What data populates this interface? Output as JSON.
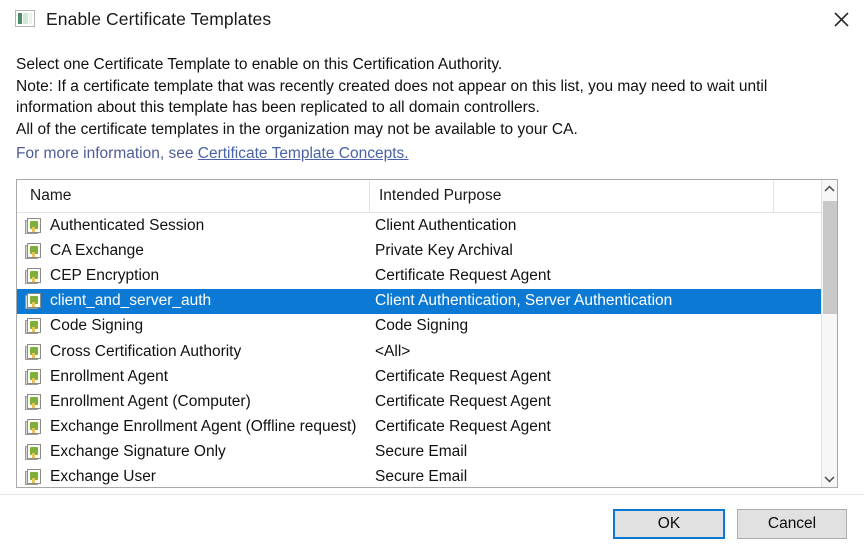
{
  "window": {
    "title": "Enable Certificate Templates",
    "icon": "certificate-templates-icon",
    "close_label": "✕",
    "accent_color": "#0c7ad4"
  },
  "description": {
    "lines": [
      "Select one Certificate Template to enable on this Certification Authority.",
      "Note: If a certificate template that was recently created does not appear on this list, you may need to wait until",
      "information about this template has been replicated to all domain controllers.",
      "All of the certificate templates in the organization may not be available to your CA."
    ],
    "link_prefix": "For more information, see ",
    "link_text": "Certificate Template Concepts.",
    "link_color": "#4a63a8"
  },
  "list": {
    "columns": [
      "Name",
      "Intended Purpose"
    ],
    "selected_index": 3,
    "rows": [
      {
        "name": "Authenticated Session",
        "purpose": "Client Authentication"
      },
      {
        "name": "CA Exchange",
        "purpose": "Private Key Archival"
      },
      {
        "name": "CEP Encryption",
        "purpose": "Certificate Request Agent"
      },
      {
        "name": "client_and_server_auth",
        "purpose": "Client Authentication, Server Authentication"
      },
      {
        "name": "Code Signing",
        "purpose": "Code Signing"
      },
      {
        "name": "Cross Certification Authority",
        "purpose": "<All>"
      },
      {
        "name": "Enrollment Agent",
        "purpose": "Certificate Request Agent"
      },
      {
        "name": "Enrollment Agent (Computer)",
        "purpose": "Certificate Request Agent"
      },
      {
        "name": "Exchange Enrollment Agent (Offline request)",
        "purpose": "Certificate Request Agent"
      },
      {
        "name": "Exchange Signature Only",
        "purpose": "Secure Email"
      },
      {
        "name": "Exchange User",
        "purpose": "Secure Email"
      }
    ],
    "selection_color": "#0c7ad4",
    "scrollbar": {
      "up_arrow": "⌃",
      "down_arrow": "⌄"
    }
  },
  "footer": {
    "ok_label": "OK",
    "cancel_label": "Cancel"
  }
}
